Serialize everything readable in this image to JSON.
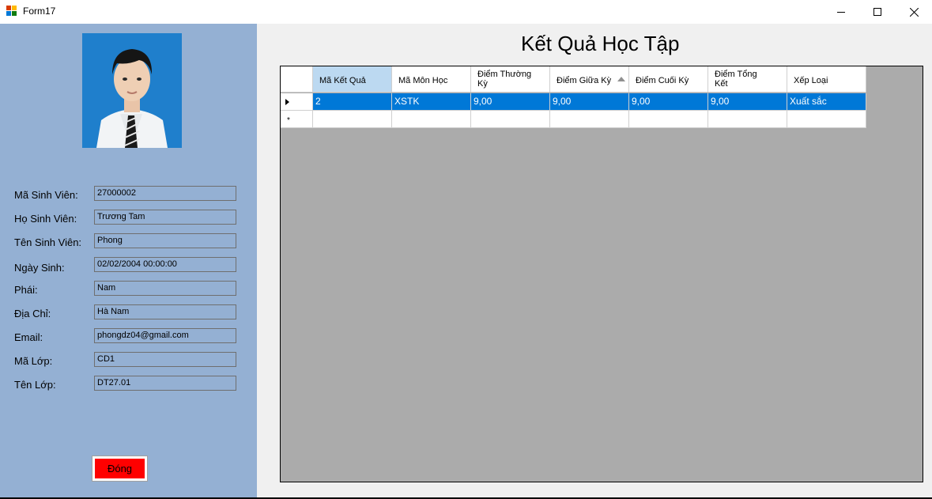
{
  "window": {
    "title": "Form17"
  },
  "page_title": "Kết Quả Học Tập",
  "student": {
    "fields": [
      {
        "label": "Mã Sinh Viên:",
        "value": "27000002"
      },
      {
        "label": "Họ Sinh Viên:",
        "value": "Trương Tam"
      },
      {
        "label": "Tên Sinh Viên:",
        "value": "Phong"
      },
      {
        "label": "Ngày Sinh:",
        "value": "02/02/2004 00:00:00"
      },
      {
        "label": "Phái:",
        "value": "Nam"
      },
      {
        "label": "Địa Chỉ:",
        "value": "Hà Nam"
      },
      {
        "label": "Email:",
        "value": "phongdz04@gmail.com"
      },
      {
        "label": "Mã Lớp:",
        "value": "CD1"
      },
      {
        "label": "Tên Lớp:",
        "value": "DT27.01"
      }
    ]
  },
  "close_button_label": "Đóng",
  "grid": {
    "columns": [
      "Mã Kết Quả",
      "Mã Môn Học",
      "Điểm Thường Kỳ",
      "Điểm Giữa Kỳ",
      "Điểm Cuối Kỳ",
      "Điểm Tổng Kết",
      "Xếp Loại"
    ],
    "rows": [
      [
        "2",
        "XSTK",
        "9,00",
        "9,00",
        "9,00",
        "9,00",
        "Xuất sắc"
      ]
    ]
  },
  "icons": {
    "app": "form-app-icon",
    "minimize": "minimize-icon",
    "maximize": "maximize-icon",
    "close": "close-icon",
    "current_row": "current-row-arrow-icon",
    "new_row": "new-row-star-icon",
    "sort": "sort-ascending-icon"
  },
  "colors": {
    "left_panel": "#94b0d3",
    "selected_row": "#0078d7",
    "close_button": "#ff0000",
    "grid_background": "#ababab"
  }
}
